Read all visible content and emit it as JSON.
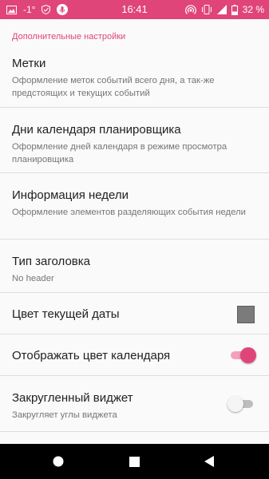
{
  "status_bar": {
    "temperature": "-1°",
    "time": "16:41",
    "battery_text": "32 %",
    "icons": [
      "photo-icon",
      "shield-icon",
      "mic-icon",
      "hotspot-icon",
      "vibrate-icon",
      "signal-icon",
      "battery-icon"
    ]
  },
  "section": {
    "header": "Дополнительные настройки"
  },
  "prefs": [
    {
      "title": "Метки",
      "summary": "Оформление меток событий всего дня, а так-же предстоящих и текущих событий"
    },
    {
      "title": "Дни календаря планировщика",
      "summary": "Оформление дней календаря в режиме просмотра планировщика"
    },
    {
      "title": "Информация недели",
      "summary": "Оформление элементов разделяющих события недели"
    },
    {
      "title": "Тип заголовка",
      "summary": "No header"
    },
    {
      "title": "Цвет текущей даты",
      "swatch_color": "#7b7b7b"
    },
    {
      "title": "Отображать цвет календаря",
      "switch_on": true
    },
    {
      "title": "Закругленный виджет",
      "summary": "Закругляет углы виджета",
      "switch_on": false
    }
  ],
  "colors": {
    "accent": "#e0457a",
    "background": "#fafafa",
    "navbar": "#000000"
  },
  "navbar": {
    "icons": [
      "home-icon",
      "recents-icon",
      "back-icon"
    ]
  }
}
